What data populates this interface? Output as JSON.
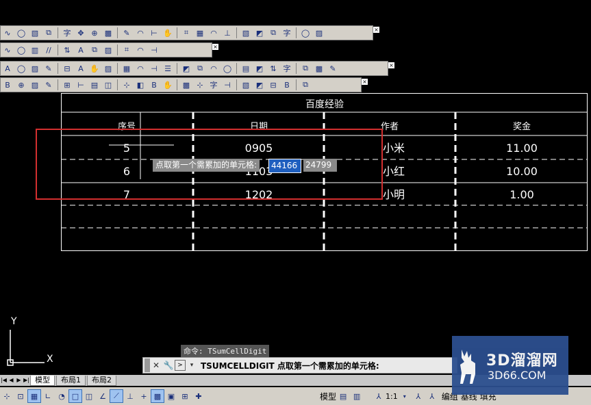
{
  "toolbars": {
    "row1_icons": [
      "grid-icon",
      "tree-icon",
      "align-icon",
      "text-style-icon",
      "insert-row-icon",
      "delete-row-icon",
      "merge-icon",
      "split-icon",
      "arc-icon",
      "bezier-icon",
      "text-icon",
      "font-icon",
      "font-bold-icon",
      "dim-icon",
      "dim2-icon",
      "dim3-icon",
      "circle-icon",
      "move-icon",
      "copy-icon",
      "zoom-icon",
      "pan-icon",
      "paste-icon"
    ],
    "row2_icons": [
      "win1-icon",
      "win2-icon",
      "win3-icon",
      "win4-icon",
      "win5-icon",
      "win6-icon",
      "win7-icon",
      "win8-icon",
      "list-icon",
      "align2-icon",
      "slash-icon"
    ],
    "row3_icons": [
      "table1-icon",
      "edit-icon",
      "layers-icon",
      "grid2-icon",
      "tree2-icon",
      "node-icon",
      "center-icon",
      "line-icon",
      "steps-icon",
      "export-icon",
      "frame-icon",
      "frame2-icon",
      "frame3-icon",
      "frame4-icon",
      "mail-icon",
      "print-icon",
      "pen-icon",
      "book-icon",
      "ruler-icon",
      "flag-icon",
      "text2-icon",
      "target-icon",
      "help-icon"
    ],
    "row4_icons": [
      "magnify-icon",
      "search2-icon",
      "table2-icon",
      "image-icon",
      "insert-icon",
      "align3-icon",
      "bracket-icon",
      "text-a-icon",
      "format-icon",
      "chart-icon",
      "abc-icon",
      "calc-icon",
      "bar-icon",
      "tile-icon",
      "ruler2-icon",
      "eye-icon",
      "pencil-icon",
      "eye2-icon",
      "window-icon",
      "frame5-icon",
      "brush-icon"
    ]
  },
  "table": {
    "title": "百度经验",
    "headers": [
      "序号",
      "日期",
      "作者",
      "奖金"
    ],
    "rows": [
      [
        "5",
        "0905",
        "小米",
        "11.00"
      ],
      [
        "6",
        "1103",
        "小红",
        "10.00"
      ],
      [
        "7",
        "1202",
        "小明",
        "1.00"
      ]
    ]
  },
  "prompt": {
    "label": "点取第一个需累加的单元格:",
    "input1": "44166",
    "input2": "24799"
  },
  "ucs": {
    "x": "X",
    "y": "Y"
  },
  "command": {
    "history": "命令: TSumCellDigit",
    "line": "TSUMCELLDIGIT 点取第一个需累加的单元格:"
  },
  "tabs": [
    "模型",
    "布局1",
    "布局2"
  ],
  "status": {
    "model": "模型",
    "scale": "1:1",
    "items": [
      "编组",
      "基线",
      "填充"
    ]
  },
  "watermark": {
    "big": "3D溜溜网",
    "small": "3D66.COM"
  },
  "colors": {
    "highlight": "#d32f2f",
    "canvas": "#000000",
    "input_selected": "#1f5fbf"
  }
}
